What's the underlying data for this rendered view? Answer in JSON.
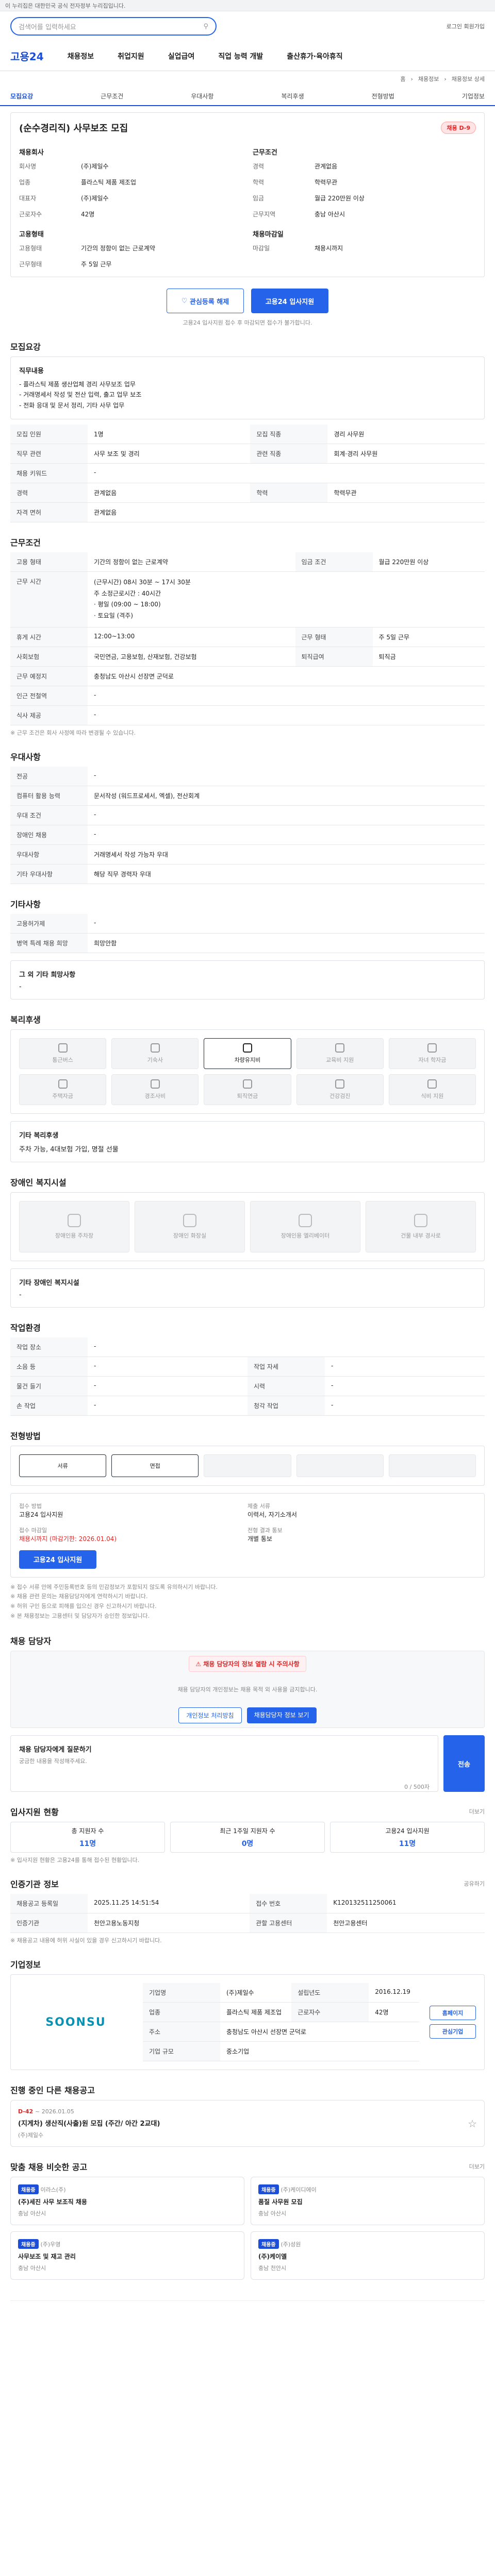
{
  "header": {
    "gov_notice": "이 누리집은 대한민국 공식 전자정부 누리집입니다.",
    "search_placeholder": "검색어를 입력하세요",
    "login": "로그인  회원가입",
    "logo": "고용24",
    "menu": [
      "채용정보",
      "취업지원",
      "실업급여",
      "직업 능력 개발",
      "출산휴가·육아휴직"
    ],
    "breadcrumb": [
      "홈",
      "채용정보",
      "채용정보 상세"
    ]
  },
  "tabs": [
    "모집요강",
    "근무조건",
    "우대사항",
    "복리후생",
    "전형방법",
    "기업정보"
  ],
  "job": {
    "badge": "채용 D-9",
    "title": "(순수경리직) 사무보조 모집",
    "company_label": "채용회사",
    "company_rows": [
      {
        "k": "회사명",
        "v": "(주)제일수"
      },
      {
        "k": "업종",
        "v": "플라스틱 제품 제조업"
      },
      {
        "k": "대표자",
        "v": "(주)제일수"
      },
      {
        "k": "근로자수",
        "v": "42명"
      }
    ],
    "cond_label": "근무조건",
    "cond_rows": [
      {
        "k": "경력",
        "v": "관계없음"
      },
      {
        "k": "학력",
        "v": "학력무관"
      },
      {
        "k": "임금",
        "v": "월급 220만원 이상"
      },
      {
        "k": "근무지역",
        "v": "충남 아산시"
      }
    ],
    "type_label": "고용형태",
    "type_rows": [
      {
        "k": "고용형태",
        "v": "기간의 정함이 없는 근로계약"
      },
      {
        "k": "근무형태",
        "v": "주 5일 근무"
      }
    ],
    "reception_label": "채용마감일",
    "reception_rows": [
      {
        "k": "마감일",
        "v": "채용시까지"
      }
    ],
    "interest_btn": "관심등록 해제",
    "apply_btn": "고용24 입사지원",
    "notice": "고용24 입사지원 접수 후 마감되면 접수가 불가합니다."
  },
  "recruit": {
    "title": "모집요강",
    "duty_label": "직무내용",
    "duty_text": "- 플라스틱 제품 생산업체 경리 사무보조 업무\n- 거래명세서 작성 및 전산 입력, 출고 업무 보조\n- 전화 응대 및 문서 정리, 기타 사무 업무",
    "rows": [
      {
        "k": "모집 인원",
        "v": "1명",
        "k2": "모집 직종",
        "v2": "경리 사무원"
      },
      {
        "k": "직무 관련",
        "v": "사무 보조 및 경리",
        "k2": "관련 직종",
        "v2": "회계·경리 사무원"
      },
      {
        "k": "채용 키워드",
        "v": "-",
        "k2": "",
        "v2": ""
      },
      {
        "k": "경력",
        "v": "관계없음",
        "k2": "학력",
        "v2": "학력무관"
      },
      {
        "k": "자격 면허",
        "v": "관계없음",
        "k2": "",
        "v2": ""
      }
    ]
  },
  "work": {
    "title": "근무조건",
    "rows": [
      {
        "k": "고용 형태",
        "v": "기간의 정함이 없는 근로계약",
        "k2": "임금 조건",
        "v2": "월급 220만원 이상"
      },
      {
        "k": "근무 시간",
        "v": "(근무시간) 08시 30분 ~ 17시 30분\n주 소정근로시간 : 40시간\n· 평일 (09:00 ~ 18:00)\n· 토요일 (격주)",
        "k2": "",
        "v2": ""
      },
      {
        "k": "휴게 시간",
        "v": "12:00~13:00",
        "k2": "근무 형태",
        "v2": "주 5일 근무"
      },
      {
        "k": "사회보험",
        "v": "국민연금, 고용보험, 산재보험, 건강보험",
        "k2": "퇴직급여",
        "v2": "퇴직금"
      },
      {
        "k": "근무 예정지",
        "v": "충청남도 아산시 선장면 군덕로",
        "k2": "",
        "v2": ""
      },
      {
        "k": "인근 전철역",
        "v": "-",
        "k2": "",
        "v2": ""
      },
      {
        "k": "식사 제공",
        "v": "-",
        "k2": "",
        "v2": ""
      }
    ],
    "footnote": "※ 근무 조건은 회사 사정에 따라 변경될 수 있습니다."
  },
  "pref": {
    "title": "우대사항",
    "rows": [
      {
        "k": "전공",
        "v": "-"
      },
      {
        "k": "컴퓨터 활용 능력",
        "v": "문서작성 (워드프로세서, 엑셀), 전산회계"
      },
      {
        "k": "우대 조건",
        "v": "-"
      },
      {
        "k": "장애인 채용",
        "v": "-"
      },
      {
        "k": "우대사항",
        "v": "거래명세서 작성 가능자 우대"
      },
      {
        "k": "기타 우대사항",
        "v": "해당 직무 경력자 우대"
      }
    ]
  },
  "etc": {
    "title": "기타사항",
    "rows": [
      {
        "k": "고용허가제",
        "v": "-"
      },
      {
        "k": "병역 특례 채용 희망",
        "v": "희망안함"
      }
    ],
    "other_label": "그 외 기타 희망사항",
    "other_value": "-"
  },
  "welfare": {
    "title": "복리후생",
    "items": [
      "통근버스",
      "기숙사",
      "차량유지비",
      "교육비 지원",
      "자녀 학자금",
      "주택자금",
      "경조사비",
      "퇴직연금",
      "건강검진",
      "식비 지원"
    ],
    "selected_index": 2,
    "other_label": "기타 복리후생",
    "other_value": "주차 가능, 4대보험 가입, 명절 선물"
  },
  "disability": {
    "title": "장애인 복지시설",
    "items": [
      "장애인용 주차장",
      "장애인 화장실",
      "장애인용 엘리베이터",
      "건물 내부 경사로"
    ],
    "other_label": "기타 장애인 복지시설",
    "other_value": "-"
  },
  "env": {
    "title": "작업환경",
    "rows": [
      {
        "k": "작업 장소",
        "v": "-",
        "k2": "",
        "v2": ""
      },
      {
        "k": "소음 등",
        "v": "-",
        "k2": "작업 자세",
        "v2": "-"
      },
      {
        "k": "물건 들기",
        "v": "-",
        "k2": "시력",
        "v2": "-"
      },
      {
        "k": "손 작업",
        "v": "-",
        "k2": "청각 작업",
        "v2": "-"
      }
    ]
  },
  "process": {
    "title": "전형방법",
    "steps": [
      "서류",
      "면접",
      "",
      "",
      ""
    ],
    "method_label": "접수 방법",
    "method_value": "고용24 입사지원",
    "docs_label": "제출 서류",
    "docs_value": "이력서, 자기소개서",
    "deadline_label": "접수 마감일",
    "deadline_value": "채용시까지 (마감기한: 2026.01.04)",
    "result_label": "전형 결과 통보",
    "result_value": "개별 통보",
    "apply_btn": "고용24 입사지원",
    "notes": [
      "※ 접수 서류 안에 주민등록번호 등의 민감정보가 포함되지 않도록 유의하시기 바랍니다.",
      "※ 채용 관련 문의는 채용담당자에게 연락하시기 바랍니다.",
      "※ 허위 구인 등으로 피해를 입으신 경우 신고하시기 바랍니다.",
      "※ 본 채용정보는 고용센터 및 담당자가 승인한 정보입니다."
    ]
  },
  "contact": {
    "title": "채용 담당자",
    "alert": "채용 담당자의 정보 열람 시 주의사항",
    "desc": "채용 담당자의 개인정보는 채용 목적 외 사용을 금지합니다.",
    "link1": "채용담당자 정보 보기",
    "link2": "개인정보 처리방침",
    "inquiry_label": "채용 담당자에게 질문하기",
    "inquiry_placeholder": "궁금한 내용을 작성해주세요.",
    "send_btn": "전송",
    "inquiry_count": "0 / 500자"
  },
  "status": {
    "title": "입사지원 현황",
    "more": "더보기",
    "items": [
      {
        "label": "총 지원자 수",
        "value": "11명"
      },
      {
        "label": "최근 1주일 지원자 수",
        "value": "0명"
      },
      {
        "label": "고용24 입사지원",
        "value": "11명"
      }
    ],
    "note": "※ 입사지원 현황은 고용24를 통해 접수된 현황입니다."
  },
  "meta": {
    "title": "인증기관 정보",
    "more": "공유하기",
    "rows": [
      {
        "k": "채용공고 등록일",
        "v": "2025.11.25 14:51:54",
        "k2": "접수 번호",
        "v2": "K120132511250061"
      },
      {
        "k": "인증기관",
        "v": "천안고용노동지청",
        "k2": "관할 고용센터",
        "v2": "천안고용센터"
      }
    ],
    "footnote": "※ 채용공고 내용에 허위 사실이 있을 경우 신고하시기 바랍니다."
  },
  "company": {
    "title": "기업정보",
    "logo_text": "SOONSU",
    "rows": [
      {
        "k": "기업명",
        "v": "(주)제일수",
        "k2": "설립년도",
        "v2": "2016.12.19"
      },
      {
        "k": "업종",
        "v": "플라스틱 제품 제조업",
        "k2": "근로자수",
        "v2": "42명"
      },
      {
        "k": "주소",
        "v": "충청남도 아산시 선장면 군덕로",
        "k2": "",
        "v2": ""
      },
      {
        "k": "기업 규모",
        "v": "중소기업",
        "k2": "",
        "v2": ""
      }
    ],
    "buttons": [
      "홈페이지",
      "관심기업"
    ]
  },
  "others": {
    "title": "진행 중인 다른 채용공고",
    "card_badge": "D-42",
    "card_title": "(지게차) 생산직(사출)원 모집 (주간/ 아간 2교대)",
    "card_company": "(주)제일수",
    "card_date": "~ 2026.01.05"
  },
  "similar": {
    "title": "맞춤 채용 비슷한 공고",
    "more": "더보기",
    "cards": [
      {
        "tag": "채용중",
        "company": "이라스(주)",
        "title": "(주)세진 사무 보조직 채용",
        "loc": "충남 아산시"
      },
      {
        "tag": "채용중",
        "company": "(주)케이디에이",
        "title": "품질 사무원 모집",
        "loc": "충남 아산시"
      },
      {
        "tag": "채용중",
        "company": "(주)우영",
        "title": "사무보조 및 재고 관리",
        "loc": "충남 아산시"
      },
      {
        "tag": "채용중",
        "company": "(주)성원",
        "title": "(주)케이엘",
        "loc": "충남 천안시"
      }
    ]
  }
}
